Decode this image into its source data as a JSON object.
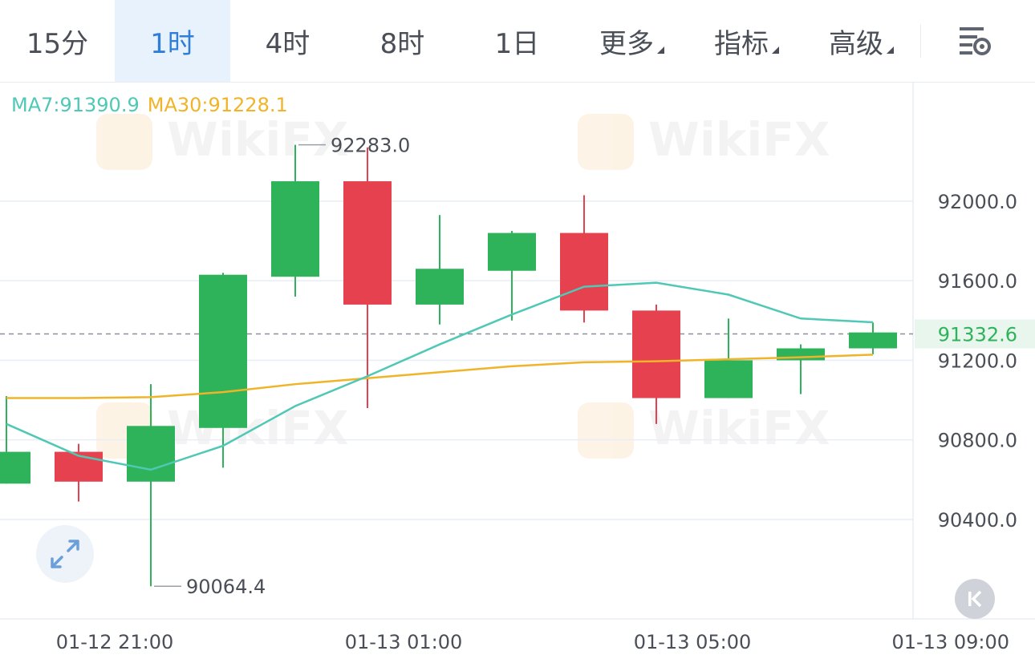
{
  "tabs": [
    {
      "label": "15分",
      "active": false,
      "dropdown": false
    },
    {
      "label": "1时",
      "active": true,
      "dropdown": false
    },
    {
      "label": "4时",
      "active": false,
      "dropdown": false
    },
    {
      "label": "8时",
      "active": false,
      "dropdown": false
    },
    {
      "label": "1日",
      "active": false,
      "dropdown": false
    },
    {
      "label": "更多",
      "active": false,
      "dropdown": true
    },
    {
      "label": "指标",
      "active": false,
      "dropdown": true
    },
    {
      "label": "高级",
      "active": false,
      "dropdown": true
    }
  ],
  "icons": {
    "settings": "settings-gear-icon",
    "expand": "expand-arrows-icon",
    "back": "go-to-latest-icon"
  },
  "legend": {
    "ma7": "MA7:91390.9",
    "ma30": "MA30:91228.1"
  },
  "watermark": "WikiFX",
  "colors": {
    "up": "#2eb35a",
    "down": "#e5414f",
    "ma7": "#4fc8b5",
    "ma30": "#f0b429",
    "active_tab": "#2f7fd8",
    "last_price": "#2eb35a"
  },
  "chart_data": {
    "type": "candlestick",
    "ylim": [
      89900,
      92600
    ],
    "yticks": [
      "92000.0",
      "91600.0",
      "91200.0",
      "90800.0",
      "90400.0"
    ],
    "ytick_values": [
      92000,
      91600,
      91200,
      90800,
      90400
    ],
    "xticks": [
      "01-12 21:00",
      "01-13 01:00",
      "01-13 05:00",
      "01-13 09:00"
    ],
    "xtick_index": [
      1.5,
      5.5,
      9.5,
      13.5
    ],
    "last_price": 91332.6,
    "last_price_label": "91332.6",
    "max_label": "92283.0",
    "max_value": 92283.0,
    "max_index": 4,
    "min_label": "90064.4",
    "min_value": 90064.4,
    "min_index": 2,
    "candles": [
      {
        "o": 90580,
        "h": 91020,
        "l": 90580,
        "c": 90740
      },
      {
        "o": 90740,
        "h": 90780,
        "l": 90490,
        "c": 90590
      },
      {
        "o": 90590,
        "h": 91080,
        "l": 90064.4,
        "c": 90870
      },
      {
        "o": 90860,
        "h": 91640,
        "l": 90660,
        "c": 91630
      },
      {
        "o": 91620,
        "h": 92283.0,
        "l": 91520,
        "c": 92100
      },
      {
        "o": 92100,
        "h": 92270,
        "l": 90960,
        "c": 91480
      },
      {
        "o": 91480,
        "h": 91930,
        "l": 91380,
        "c": 91660
      },
      {
        "o": 91650,
        "h": 91850,
        "l": 91400,
        "c": 91840
      },
      {
        "o": 91840,
        "h": 92030,
        "l": 91390,
        "c": 91450
      },
      {
        "o": 91450,
        "h": 91480,
        "l": 90880,
        "c": 91010
      },
      {
        "o": 91010,
        "h": 91410,
        "l": 91010,
        "c": 91200
      },
      {
        "o": 91200,
        "h": 91280,
        "l": 91030,
        "c": 91260
      },
      {
        "o": 91260,
        "h": 91390,
        "l": 91230,
        "c": 91340
      }
    ],
    "ma7": [
      90880,
      90720,
      90650,
      90770,
      90970,
      91120,
      91280,
      91430,
      91570,
      91590,
      91530,
      91410,
      91390.9
    ],
    "ma30": [
      91010,
      91010,
      91015,
      91040,
      91080,
      91110,
      91140,
      91170,
      91190,
      91195,
      91205,
      91215,
      91228.1
    ]
  }
}
